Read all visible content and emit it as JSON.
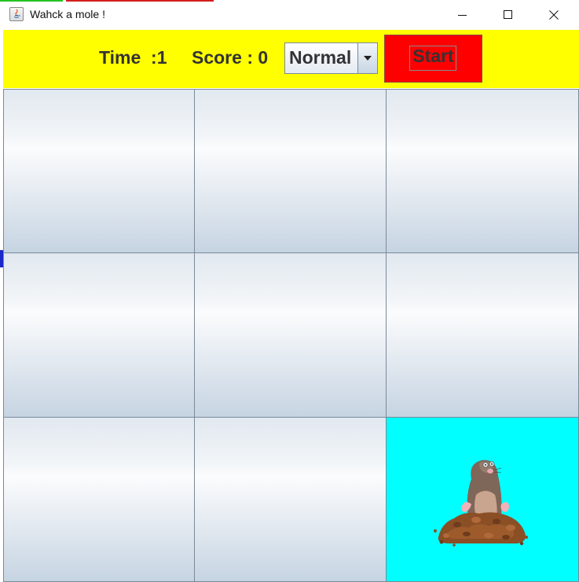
{
  "window": {
    "title": "Wahck a mole !"
  },
  "toolbar": {
    "time_label": "Time  :1",
    "score_label": "Score : 0",
    "difficulty": {
      "selected": "Normal"
    },
    "start_label": "Start"
  },
  "board": {
    "rows": 3,
    "cols": 3,
    "mole_position": {
      "row": 3,
      "col": 3
    }
  },
  "colors": {
    "toolbar_bg": "#ffff00",
    "start_bg": "#ff0000",
    "active_hole_bg": "#00ffff"
  },
  "icons": [
    "java-app-icon",
    "minimize-icon",
    "maximize-icon",
    "close-icon",
    "chevron-down-icon",
    "mole-icon"
  ]
}
